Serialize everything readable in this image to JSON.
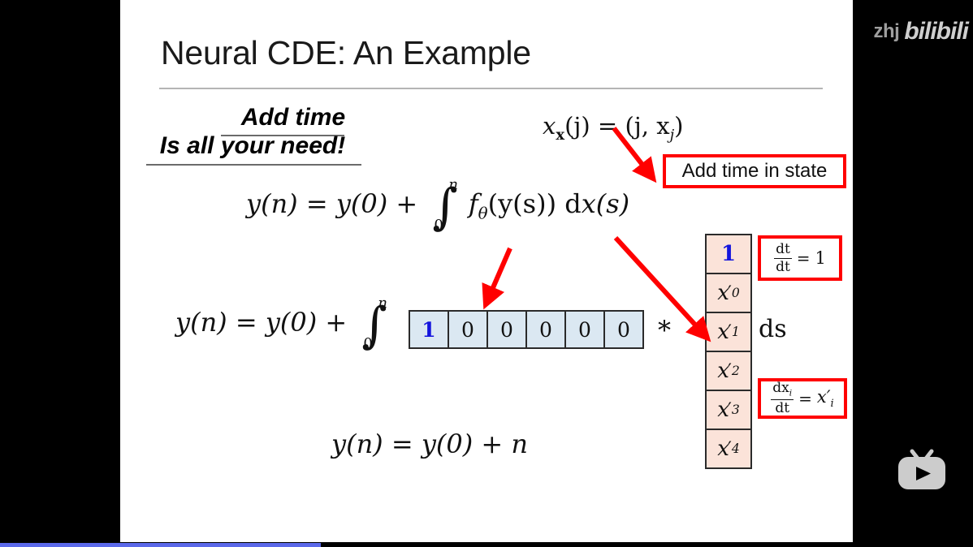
{
  "player": {
    "watermark_uploader": "zhj",
    "watermark_brand": "bilibili",
    "tv_logo_name": "bilibili-tv-logo",
    "progress_percent": 33,
    "progress_color": "#5b69ea",
    "background_color": "#000000"
  },
  "slide": {
    "title": "Neural CDE: An Example",
    "headline_line1": "Add time",
    "headline_line2": "Is all your need!",
    "equations": {
      "x_definition": "xₓ(j) = (j, xⱼ)",
      "x_def_parts": {
        "lhs_var": "x",
        "lhs_sub": "x",
        "lhs_arg": "(j)",
        "eq": "=",
        "rhs": "(j, x",
        "rhs_sub": "j",
        "rhs_close": ")"
      },
      "cde_general": "y(n) = y(0) + ∫₀ⁿ fθ(y(s)) dx(s)",
      "cde_general_parts": {
        "lhs": "y(n)",
        "eq": "=",
        "y0": "y(0)",
        "plus": "+",
        "int_upper": "n",
        "int_lower": "0",
        "integrand_f": "f",
        "integrand_theta": "θ",
        "integrand_arg": "(y(s))",
        "measure_d": "d",
        "measure_x": "x(s)"
      },
      "cde_expanded_parts": {
        "lhs": "y(n)",
        "eq": "=",
        "y0": "y(0)",
        "plus": "+",
        "int_upper": "n",
        "int_lower": "0",
        "times": "*",
        "measure": "ds"
      },
      "cde_result": "y(n) = y(0) + n",
      "cde_result_parts": {
        "lhs": "y(n)",
        "eq": "=",
        "y0": "y(0)",
        "plus": "+",
        "rhs": "n"
      }
    },
    "row_vector": {
      "label": "f-theta-row-vector",
      "fill_color": "#dbe8f2",
      "cells": [
        {
          "value": "1",
          "highlight": true
        },
        {
          "value": "0",
          "highlight": false
        },
        {
          "value": "0",
          "highlight": false
        },
        {
          "value": "0",
          "highlight": false
        },
        {
          "value": "0",
          "highlight": false
        },
        {
          "value": "0",
          "highlight": false
        }
      ]
    },
    "column_vector": {
      "label": "dx-ds-column-vector",
      "fill_color": "#fbe3d9",
      "cells": [
        {
          "base": "1",
          "sub": "",
          "prime": false,
          "highlight": true
        },
        {
          "base": "x",
          "sub": "0",
          "prime": true,
          "highlight": false
        },
        {
          "base": "x",
          "sub": "1",
          "prime": true,
          "highlight": false
        },
        {
          "base": "x",
          "sub": "2",
          "prime": true,
          "highlight": false
        },
        {
          "base": "x",
          "sub": "3",
          "prime": true,
          "highlight": false
        },
        {
          "base": "x",
          "sub": "4",
          "prime": true,
          "highlight": false
        }
      ]
    },
    "callouts": {
      "add_time_in_state": "Add time in state",
      "dt_dt": {
        "numerator": "dt",
        "denominator": "dt",
        "equals": "=",
        "result": "1"
      },
      "dx_dt": {
        "numerator": "dxᵢ",
        "numerator_base": "dx",
        "numerator_sub": "i",
        "denominator": "dt",
        "equals": "=",
        "result_base": "x",
        "result_sub": "i",
        "result_prime": "′"
      },
      "border_color": "#ff0000"
    },
    "colors": {
      "highlight_blue": "#1414dd",
      "row_fill": "#dbe8f2",
      "col_fill": "#fbe3d9",
      "arrow_red": "#ff0000",
      "rule_gray": "#b5b5b5"
    }
  }
}
